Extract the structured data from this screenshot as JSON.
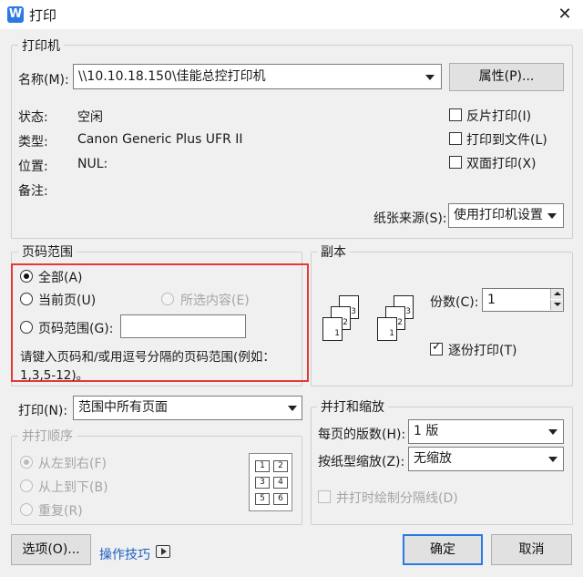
{
  "window": {
    "title": "打印",
    "close_glyph": "✕",
    "icon": "wps-writer-icon"
  },
  "printer_group": {
    "legend": "打印机",
    "name_label": "名称(M):",
    "name_value": "\\\\10.10.18.150\\佳能总控打印机",
    "properties_button": "属性(P)...",
    "status_label": "状态:",
    "status_value": "空闲",
    "type_label": "类型:",
    "type_value": "Canon Generic Plus UFR II",
    "where_label": "位置:",
    "where_value": "NUL:",
    "comment_label": "备注:",
    "reverse_print": {
      "label": "反片打印(I)",
      "checked": false
    },
    "print_to_file": {
      "label": "打印到文件(L)",
      "checked": false
    },
    "duplex": {
      "label": "双面打印(X)",
      "checked": false
    },
    "paper_source_label": "纸张来源(S):",
    "paper_source_value": "使用打印机设置"
  },
  "page_range": {
    "legend": "页码范围",
    "all_label": "全部(A)",
    "current_label": "当前页(U)",
    "selection_label": "所选内容(E)",
    "pages_label": "页码范围(G):",
    "pages_value": "",
    "selected": "all",
    "hint_line1": "请键入页码和/或用逗号分隔的页码范围(例如：",
    "hint_line2": "1,3,5-12)。",
    "highlight_color": "#e53935"
  },
  "copies": {
    "legend": "副本",
    "count_label": "份数(C):",
    "count_value": "1",
    "collate": {
      "label": "逐份打印(T)",
      "checked": true
    },
    "sheet_numbers": [
      "1",
      "2",
      "3"
    ]
  },
  "print_what": {
    "label": "打印(N):",
    "value": "范围中所有页面"
  },
  "print_order": {
    "legend": "并打顺序",
    "left_to_right": "从左到右(F)",
    "top_to_bottom": "从上到下(B)",
    "repeat": "重复(R)",
    "selected": "left_to_right",
    "preview_numbers": [
      "1",
      "2",
      "3",
      "4",
      "5",
      "6"
    ]
  },
  "zoom": {
    "legend": "并打和缩放",
    "pages_per_sheet_label": "每页的版数(H):",
    "pages_per_sheet_value": "1 版",
    "scale_label": "按纸型缩放(Z):",
    "scale_value": "无缩放",
    "draw_borders": {
      "label": "并打时绘制分隔线(D)",
      "checked": false
    }
  },
  "footer": {
    "options_button": "选项(O)...",
    "tips_link": "操作技巧",
    "ok_button": "确定",
    "cancel_button": "取消"
  },
  "colors": {
    "accent": "#2b79e4",
    "window_bg": "#f0f0f0",
    "link": "#1e5fc0"
  }
}
